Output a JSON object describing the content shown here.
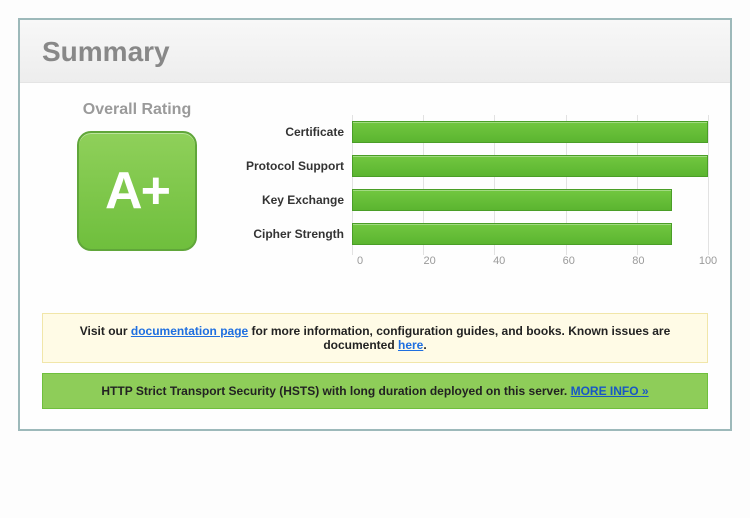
{
  "title": "Summary",
  "rating": {
    "label": "Overall Rating",
    "grade": "A+"
  },
  "chart_data": {
    "type": "bar",
    "categories": [
      "Certificate",
      "Protocol Support",
      "Key Exchange",
      "Cipher Strength"
    ],
    "values": [
      100,
      100,
      90,
      90
    ],
    "ylim": [
      0,
      100
    ],
    "xlabel": "",
    "ylabel": "",
    "ticks": [
      0,
      20,
      40,
      60,
      80,
      100
    ],
    "title": ""
  },
  "notices": {
    "docs": {
      "prefix": "Visit our ",
      "link_text": "documentation page",
      "middle": " for more information, configuration guides, and books. Known issues are documented ",
      "here_text": "here",
      "suffix": "."
    },
    "hsts": {
      "text": "HTTP Strict Transport Security (HSTS) with long duration deployed on this server.  ",
      "more": "MORE INFO »"
    }
  }
}
